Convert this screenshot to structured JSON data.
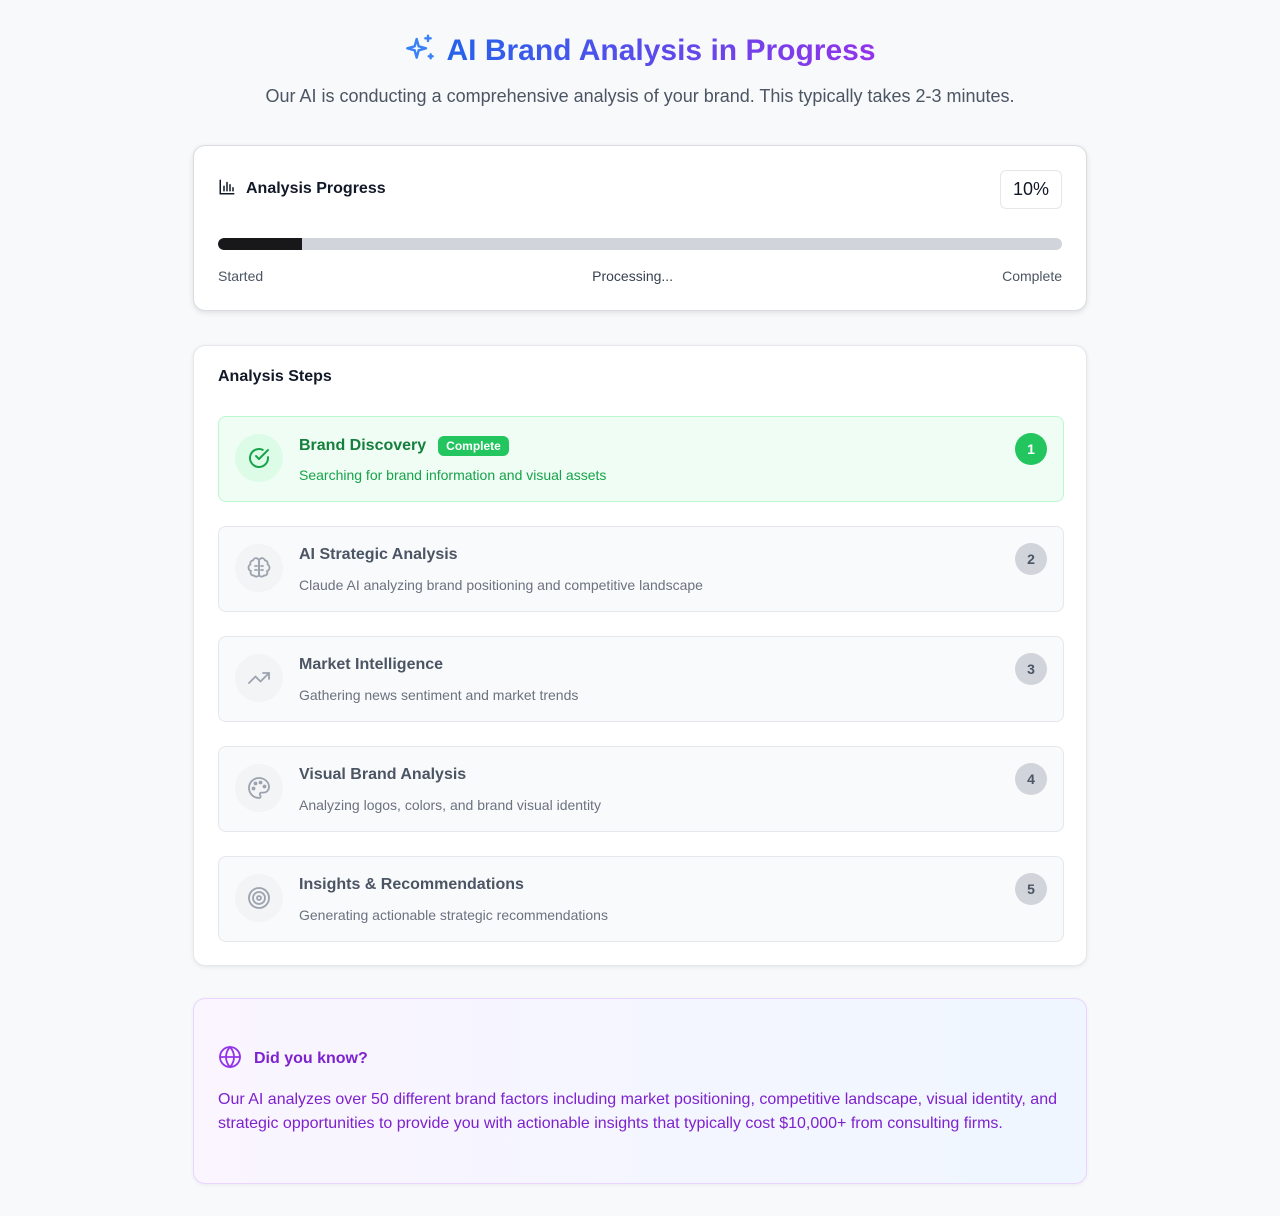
{
  "header": {
    "title": "AI Brand Analysis in Progress",
    "subtitle": "Our AI is conducting a comprehensive analysis of your brand. This typically takes 2-3 minutes.",
    "icon": "sparkles-icon"
  },
  "progress": {
    "title": "Analysis Progress",
    "icon": "bar-chart-icon",
    "percent_label": "10%",
    "percent": 10,
    "labels": {
      "start": "Started",
      "middle": "Processing...",
      "end": "Complete"
    }
  },
  "steps": {
    "title": "Analysis Steps",
    "items": [
      {
        "number": "1",
        "name": "Brand Discovery",
        "badge": "Complete",
        "description": "Searching for brand information and visual assets",
        "icon": "check-circle-icon",
        "status": "complete"
      },
      {
        "number": "2",
        "name": "AI Strategic Analysis",
        "badge": "",
        "description": "Claude AI analyzing brand positioning and competitive landscape",
        "icon": "brain-icon",
        "status": "pending"
      },
      {
        "number": "3",
        "name": "Market Intelligence",
        "badge": "",
        "description": "Gathering news sentiment and market trends",
        "icon": "trending-up-icon",
        "status": "pending"
      },
      {
        "number": "4",
        "name": "Visual Brand Analysis",
        "badge": "",
        "description": "Analyzing logos, colors, and brand visual identity",
        "icon": "palette-icon",
        "status": "pending"
      },
      {
        "number": "5",
        "name": "Insights & Recommendations",
        "badge": "",
        "description": "Generating actionable strategic recommendations",
        "icon": "target-icon",
        "status": "pending"
      }
    ]
  },
  "tip": {
    "title": "Did you know?",
    "icon": "globe-icon",
    "text": "Our AI analyzes over 50 different brand factors including market positioning, competitive landscape, visual identity, and strategic opportunities to provide you with actionable insights that typically cost $10,000+ from consulting firms."
  },
  "colors": {
    "brand_blue": "#2563eb",
    "brand_purple": "#9333ea",
    "success": "#22c55e",
    "tip_text": "#7e22ce"
  }
}
